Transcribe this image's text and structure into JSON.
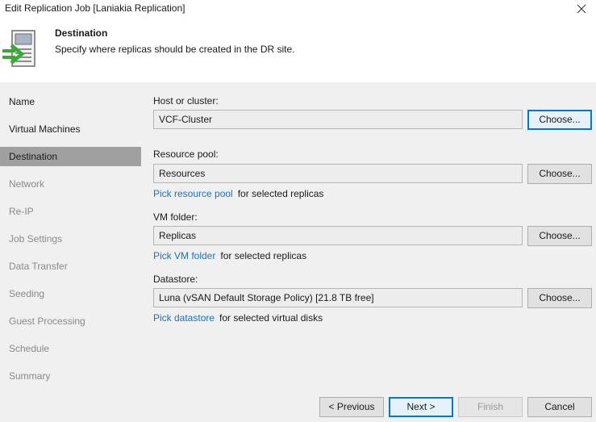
{
  "window": {
    "title": "Edit Replication Job [Laniakia Replication]"
  },
  "header": {
    "title": "Destination",
    "subtitle": "Specify where replicas should be created in the DR site."
  },
  "sidebar": {
    "items": [
      {
        "label": "Name",
        "state": "enabled"
      },
      {
        "label": "Virtual Machines",
        "state": "enabled"
      },
      {
        "label": "Destination",
        "state": "active"
      },
      {
        "label": "Network",
        "state": "disabled"
      },
      {
        "label": "Re-IP",
        "state": "disabled"
      },
      {
        "label": "Job Settings",
        "state": "disabled"
      },
      {
        "label": "Data Transfer",
        "state": "disabled"
      },
      {
        "label": "Seeding",
        "state": "disabled"
      },
      {
        "label": "Guest Processing",
        "state": "disabled"
      },
      {
        "label": "Schedule",
        "state": "disabled"
      },
      {
        "label": "Summary",
        "state": "disabled"
      }
    ]
  },
  "form": {
    "host": {
      "label": "Host or cluster:",
      "value": "VCF-Cluster",
      "button": "Choose..."
    },
    "resource_pool": {
      "label": "Resource pool:",
      "value": "Resources",
      "button": "Choose...",
      "link": "Pick resource pool",
      "link_suffix": "for selected replicas"
    },
    "vm_folder": {
      "label": "VM folder:",
      "value": "Replicas",
      "button": "Choose...",
      "link": "Pick VM folder",
      "link_suffix": "for selected replicas"
    },
    "datastore": {
      "label": "Datastore:",
      "value": "Luna (vSAN Default Storage Policy) [21.8 TB free]",
      "button": "Choose...",
      "link": "Pick datastore",
      "link_suffix": "for selected virtual disks"
    }
  },
  "footer": {
    "previous": "< Previous",
    "next": "Next >",
    "finish": "Finish",
    "cancel": "Cancel"
  },
  "colors": {
    "active_nav": "#a0a0a0",
    "link": "#1a70c8",
    "focus": "#0078d7",
    "icon_green": "#3aaa35"
  },
  "icons": {
    "close": "close-icon",
    "header": "server-arrow-icon"
  }
}
